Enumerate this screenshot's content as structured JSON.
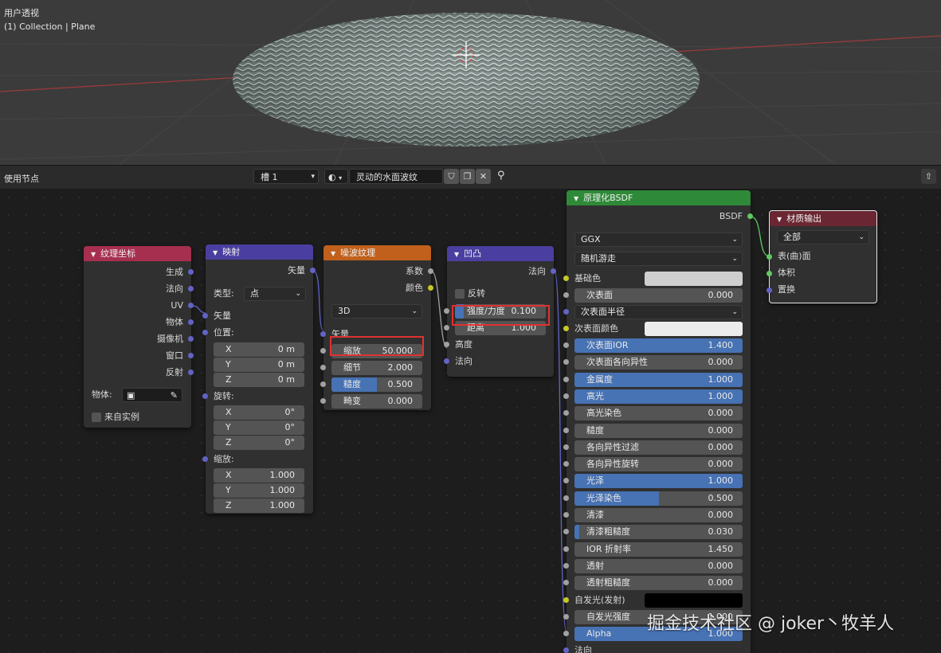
{
  "viewport": {
    "title": "用户透视",
    "subtitle": "(1) Collection | Plane"
  },
  "header": {
    "editor_mode": "使用节点",
    "slot": "槽 1",
    "material_name": "灵动的水面波纹",
    "shield_icon": "shield-icon",
    "copy_icon": "copy-icon",
    "close_icon": "close-icon",
    "pin_icon": "pin-icon",
    "up_icon": "arrow-up-icon"
  },
  "nodes": {
    "texcoord": {
      "title": "纹理坐标",
      "color": "#a62f4f",
      "outputs": [
        "生成",
        "法向",
        "UV",
        "物体",
        "摄像机",
        "窗口",
        "反射"
      ],
      "object_label": "物体:",
      "instancer_label": "来自实例"
    },
    "mapping": {
      "title": "映射",
      "color": "#4a3fa0",
      "output_vector": "矢量",
      "type_label": "类型:",
      "type_value": "点",
      "input_vector": "矢量",
      "location_label": "位置:",
      "location": [
        {
          "axis": "X",
          "value": "0 m"
        },
        {
          "axis": "Y",
          "value": "0 m"
        },
        {
          "axis": "Z",
          "value": "0 m"
        }
      ],
      "rotation_label": "旋转:",
      "rotation": [
        {
          "axis": "X",
          "value": "0°"
        },
        {
          "axis": "Y",
          "value": "0°"
        },
        {
          "axis": "Z",
          "value": "0°"
        }
      ],
      "scale_label": "缩放:",
      "scale": [
        {
          "axis": "X",
          "value": "1.000"
        },
        {
          "axis": "Y",
          "value": "1.000"
        },
        {
          "axis": "Z",
          "value": "1.000"
        }
      ]
    },
    "noise": {
      "title": "噪波纹理",
      "color": "#c0601c",
      "out_fac": "系数",
      "out_color": "颜色",
      "dimension": "3D",
      "input_vector": "矢量",
      "fields": [
        {
          "label": "缩放",
          "value": "50.000",
          "fill": 0
        },
        {
          "label": "细节",
          "value": "2.000",
          "fill": 0
        },
        {
          "label": "糙度",
          "value": "0.500",
          "fill": 0.5
        },
        {
          "label": "畸变",
          "value": "0.000",
          "fill": 0
        }
      ]
    },
    "bump": {
      "title": "凹凸",
      "color": "#4a3fa0",
      "out_normal": "法向",
      "invert_label": "反转",
      "fields": [
        {
          "label": "强度/力度",
          "value": "0.100",
          "fill": 0.1
        },
        {
          "label": "距离",
          "value": "1.000",
          "fill": 0
        }
      ],
      "in_height": "高度",
      "in_normal": "法向"
    },
    "bsdf": {
      "title": "原理化BSDF",
      "color": "#2e8a38",
      "output": "BSDF",
      "distribution": "GGX",
      "subsurface_method": "随机游走",
      "base_color_label": "基础色",
      "base_color": "#cfcfcf",
      "subsurface": {
        "label": "次表面",
        "value": "0.000",
        "fill": 0
      },
      "subsurface_radius": "次表面半径",
      "subsurface_color_label": "次表面颜色",
      "subsurface_color": "#ececec",
      "fields": [
        {
          "label": "次表面IOR",
          "value": "1.400",
          "fill": 1
        },
        {
          "label": "次表面各向异性",
          "value": "0.000",
          "fill": 0
        },
        {
          "label": "金属度",
          "value": "1.000",
          "fill": 1
        },
        {
          "label": "高光",
          "value": "1.000",
          "fill": 1
        },
        {
          "label": "高光染色",
          "value": "0.000",
          "fill": 0
        },
        {
          "label": "糙度",
          "value": "0.000",
          "fill": 0
        },
        {
          "label": "各向异性过滤",
          "value": "0.000",
          "fill": 0
        },
        {
          "label": "各向异性旋转",
          "value": "0.000",
          "fill": 0
        },
        {
          "label": "光泽",
          "value": "1.000",
          "fill": 1
        },
        {
          "label": "光泽染色",
          "value": "0.500",
          "fill": 0.5
        },
        {
          "label": "清漆",
          "value": "0.000",
          "fill": 0
        },
        {
          "label": "清漆粗糙度",
          "value": "0.030",
          "fill": 0.03
        },
        {
          "label": "IOR 折射率",
          "value": "1.450",
          "fill": 0
        },
        {
          "label": "透射",
          "value": "0.000",
          "fill": 0
        },
        {
          "label": "透射粗糙度",
          "value": "0.000",
          "fill": 0
        }
      ],
      "emission_label": "自发光(发射)",
      "emission_color": "#000000",
      "emission_strength": {
        "label": "自发光强度",
        "value": "1.000",
        "fill": 0
      },
      "alpha": {
        "label": "Alpha",
        "value": "1.000",
        "fill": 1
      },
      "normal_label": "法向"
    },
    "output": {
      "title": "材质输出",
      "color": "#6a2632",
      "target": "全部",
      "inputs": [
        "表(曲)面",
        "体积",
        "置换"
      ]
    }
  },
  "watermark": "掘金技术社区 @ joker丶牧羊人"
}
